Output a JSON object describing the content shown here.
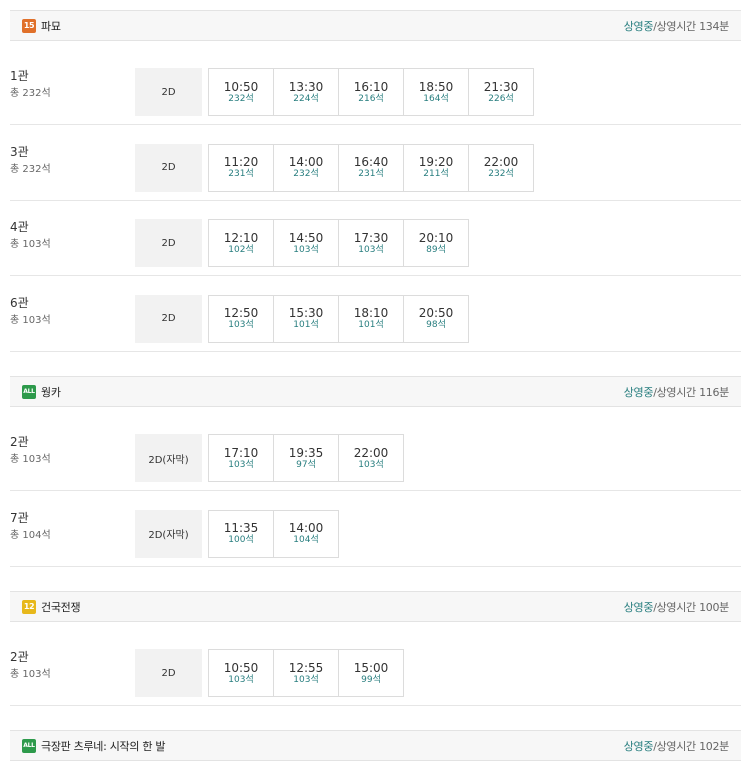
{
  "movies": [
    {
      "rating": "15",
      "rating_class": "r15",
      "title": "파묘",
      "status": "상영중",
      "runtime": "/상영시간 134분",
      "halls": [
        {
          "name": "1관",
          "seats": "총 232석",
          "format": "2D",
          "times": [
            {
              "time": "10:50",
              "seats": "232석"
            },
            {
              "time": "13:30",
              "seats": "224석"
            },
            {
              "time": "16:10",
              "seats": "216석"
            },
            {
              "time": "18:50",
              "seats": "164석"
            },
            {
              "time": "21:30",
              "seats": "226석"
            }
          ]
        },
        {
          "name": "3관",
          "seats": "총 232석",
          "format": "2D",
          "times": [
            {
              "time": "11:20",
              "seats": "231석"
            },
            {
              "time": "14:00",
              "seats": "232석"
            },
            {
              "time": "16:40",
              "seats": "231석"
            },
            {
              "time": "19:20",
              "seats": "211석"
            },
            {
              "time": "22:00",
              "seats": "232석"
            }
          ]
        },
        {
          "name": "4관",
          "seats": "총 103석",
          "format": "2D",
          "times": [
            {
              "time": "12:10",
              "seats": "102석"
            },
            {
              "time": "14:50",
              "seats": "103석"
            },
            {
              "time": "17:30",
              "seats": "103석"
            },
            {
              "time": "20:10",
              "seats": "89석"
            }
          ]
        },
        {
          "name": "6관",
          "seats": "총 103석",
          "format": "2D",
          "times": [
            {
              "time": "12:50",
              "seats": "103석"
            },
            {
              "time": "15:30",
              "seats": "101석"
            },
            {
              "time": "18:10",
              "seats": "101석"
            },
            {
              "time": "20:50",
              "seats": "98석"
            }
          ]
        }
      ]
    },
    {
      "rating": "ALL",
      "rating_class": "rall",
      "title": "웡카",
      "status": "상영중",
      "runtime": "/상영시간 116분",
      "halls": [
        {
          "name": "2관",
          "seats": "총 103석",
          "format": "2D(자막)",
          "times": [
            {
              "time": "17:10",
              "seats": "103석"
            },
            {
              "time": "19:35",
              "seats": "97석"
            },
            {
              "time": "22:00",
              "seats": "103석"
            }
          ]
        },
        {
          "name": "7관",
          "seats": "총 104석",
          "format": "2D(자막)",
          "times": [
            {
              "time": "11:35",
              "seats": "100석"
            },
            {
              "time": "14:00",
              "seats": "104석"
            }
          ]
        }
      ]
    },
    {
      "rating": "12",
      "rating_class": "r12",
      "title": "건국전쟁",
      "status": "상영중",
      "runtime": "/상영시간 100분",
      "halls": [
        {
          "name": "2관",
          "seats": "총 103석",
          "format": "2D",
          "times": [
            {
              "time": "10:50",
              "seats": "103석"
            },
            {
              "time": "12:55",
              "seats": "103석"
            },
            {
              "time": "15:00",
              "seats": "99석"
            }
          ]
        }
      ]
    },
    {
      "rating": "ALL",
      "rating_class": "rall",
      "title": "극장판 츠루네: 시작의 한 발",
      "status": "상영중",
      "runtime": "/상영시간 102분",
      "halls": []
    }
  ]
}
